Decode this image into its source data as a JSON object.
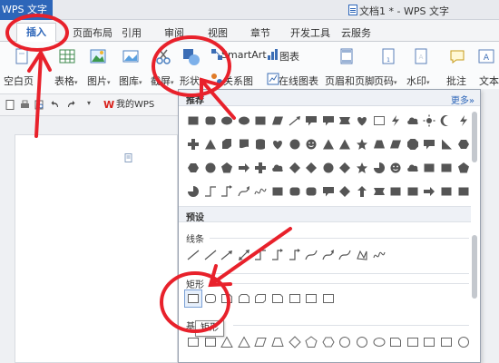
{
  "titlebar": {
    "app_menu": "WPS 文字",
    "doc_title": "文档1 * - WPS 文字"
  },
  "tabs": [
    "插入",
    "页面布局",
    "引用",
    "审阅",
    "视图",
    "章节",
    "开发工具",
    "云服务"
  ],
  "ribbon": {
    "blank_page": "空白页",
    "table": "表格",
    "picture": "图片",
    "gallery": "图库",
    "screenshot": "截屏",
    "shapes": "形状",
    "smartart": "SmartArt",
    "chart": "图表",
    "relation": "关系图",
    "online_chart": "在线图表",
    "header_footer": "页眉和页脚",
    "page_number": "页码",
    "watermark": "水印",
    "comment": "批注",
    "textbox": "文本"
  },
  "quick_access": {
    "wps_tab": "我的WPS"
  },
  "shapes_panel": {
    "recommended": "推荐",
    "more": "更多»",
    "preset": "预设",
    "lines": "线条",
    "rectangles": "矩形",
    "basic": "基本形状"
  },
  "tooltip": "矩形",
  "colors": {
    "accent": "#2d66b9",
    "annotation": "#e8212b"
  }
}
